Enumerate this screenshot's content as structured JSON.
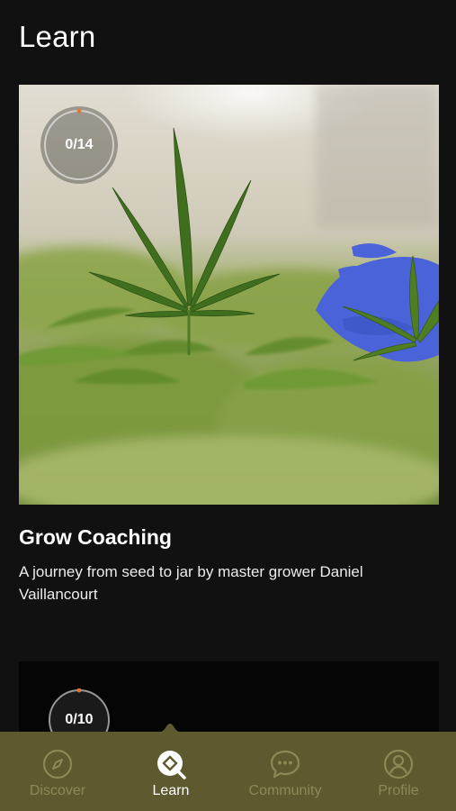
{
  "page": {
    "title": "Learn"
  },
  "courses": [
    {
      "progress": "0/14",
      "progress_fraction": 0.0,
      "title": "Grow Coaching",
      "description": "A journey from seed to jar by master grower Daniel Vaillancourt"
    },
    {
      "progress": "0/10",
      "progress_fraction": 0.0
    }
  ],
  "nav": {
    "items": [
      {
        "label": "Discover",
        "icon": "compass-icon",
        "active": false
      },
      {
        "label": "Learn",
        "icon": "learn-search-icon",
        "active": true
      },
      {
        "label": "Community",
        "icon": "chat-bubble-icon",
        "active": false
      },
      {
        "label": "Profile",
        "icon": "user-icon",
        "active": false
      }
    ]
  },
  "colors": {
    "background": "#111111",
    "nav_background": "#5d5a30",
    "nav_inactive": "#8c8856",
    "progress_accent": "#e0763a",
    "glove_blue": "#4a63d8"
  }
}
